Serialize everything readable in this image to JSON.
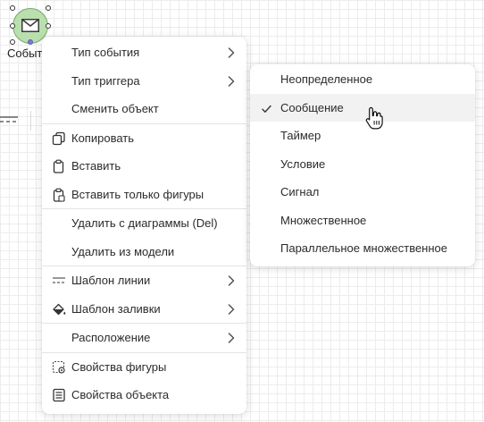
{
  "canvas": {
    "event_label": "Событие",
    "event_color": "#b9dfae"
  },
  "main_menu": {
    "groups": [
      [
        {
          "label": "Тип события",
          "icon": "",
          "submenu": true
        },
        {
          "label": "Тип триггера",
          "icon": "",
          "submenu": true
        },
        {
          "label": "Сменить объект",
          "icon": "",
          "submenu": false
        }
      ],
      [
        {
          "label": "Копировать",
          "icon": "copy-icon",
          "submenu": false
        },
        {
          "label": "Вставить",
          "icon": "paste-icon",
          "submenu": false
        },
        {
          "label": "Вставить только фигуры",
          "icon": "paste-shapes-icon",
          "submenu": false
        }
      ],
      [
        {
          "label": "Удалить с диаграммы (Del)",
          "icon": "",
          "submenu": false
        },
        {
          "label": "Удалить из модели",
          "icon": "",
          "submenu": false
        }
      ],
      [
        {
          "label": "Шаблон линии",
          "icon": "line-template-icon",
          "submenu": true
        },
        {
          "label": "Шаблон заливки",
          "icon": "fill-bucket-icon",
          "submenu": true
        }
      ],
      [
        {
          "label": "Расположение",
          "icon": "",
          "submenu": true
        }
      ],
      [
        {
          "label": "Свойства фигуры",
          "icon": "shape-properties-icon",
          "submenu": false
        },
        {
          "label": "Свойства объекта",
          "icon": "object-properties-icon",
          "submenu": false
        }
      ]
    ]
  },
  "trigger_submenu": {
    "items": [
      {
        "label": "Неопределенное",
        "checked": false,
        "hover": false
      },
      {
        "label": "Сообщение",
        "checked": true,
        "hover": true
      },
      {
        "label": "Таймер",
        "checked": false,
        "hover": false
      },
      {
        "label": "Условие",
        "checked": false,
        "hover": false
      },
      {
        "label": "Сигнал",
        "checked": false,
        "hover": false
      },
      {
        "label": "Множественное",
        "checked": false,
        "hover": false
      },
      {
        "label": "Параллельное множественное",
        "checked": false,
        "hover": false
      }
    ]
  },
  "colors": {
    "hover_background": "#f2f2f2",
    "separator": "#e4e4e4"
  }
}
